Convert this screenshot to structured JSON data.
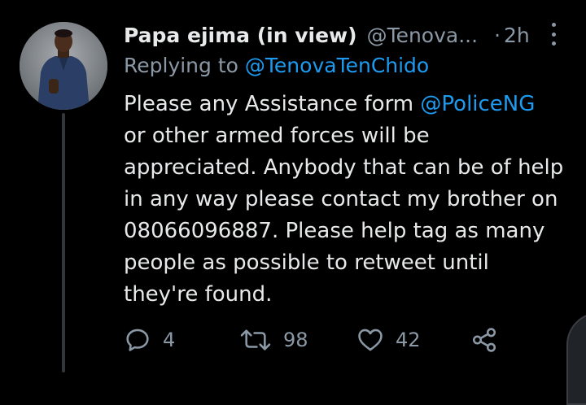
{
  "tweet": {
    "author_name": "Papa ejima (in view)",
    "author_handle": "@Tenova...",
    "time": "2h",
    "replying_prefix": "Replying to",
    "replying_to": "@TenovaTenChido",
    "body": {
      "line1_pre": "Please any Assistance form ",
      "mention": "@PoliceNG",
      "line2": "or other armed forces will be",
      "line3": "appreciated. Anybody that can be of help",
      "line4": "in any way please contact my brother on",
      "line5": "08066096887. Please help tag as many",
      "line6": "people as possible to retweet until",
      "line7": "they're found."
    },
    "actions": {
      "replies": "4",
      "retweets": "98",
      "likes": "42"
    }
  },
  "colors": {
    "background": "#000000",
    "text": "#e7e9ea",
    "muted": "#8b98a5",
    "link": "#1d9bf0"
  },
  "icons": [
    "more-vertical-icon",
    "reply-icon",
    "retweet-icon",
    "heart-icon",
    "share-icon"
  ]
}
